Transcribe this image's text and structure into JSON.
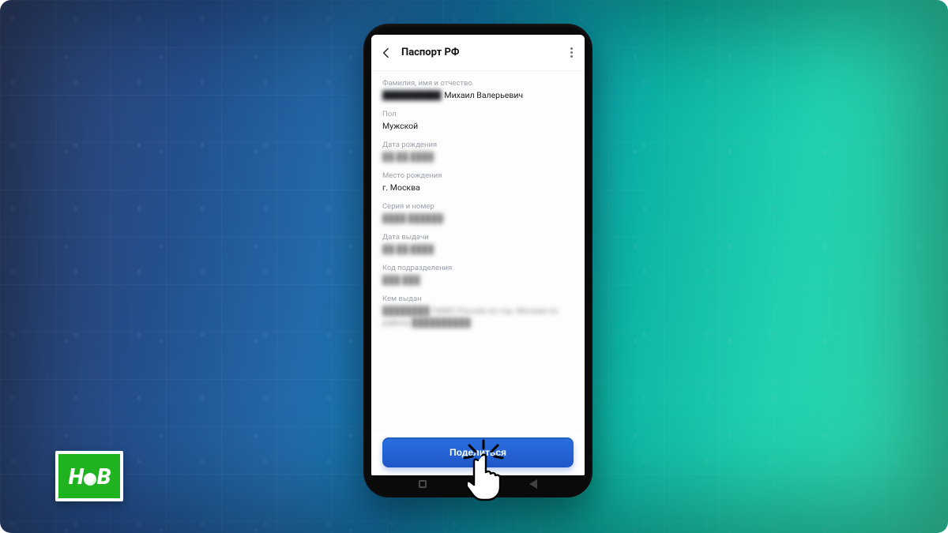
{
  "logo": {
    "left": "Н",
    "right": "В"
  },
  "appbar": {
    "title": "Паспорт РФ",
    "back_icon": "arrow-left",
    "more_icon": "more-vertical"
  },
  "fields": {
    "full_name": {
      "label": "Фамилия, имя и отчество",
      "value_hidden": "██████████",
      "value_visible": "Михаил Валерьевич"
    },
    "gender": {
      "label": "Пол",
      "value": "Мужской"
    },
    "birth_date": {
      "label": "Дата рождения",
      "value_hidden": "██.██.████"
    },
    "birth_place": {
      "label": "Место рождения",
      "value": "г. Москва"
    },
    "series_number": {
      "label": "Серия и номер",
      "value_hidden": "████ ██████"
    },
    "issue_date": {
      "label": "Дата выдачи",
      "value_hidden": "██.██.████"
    },
    "dept_code": {
      "label": "Код подразделения",
      "value_hidden": "███-███"
    },
    "issued_by": {
      "label": "Кем выдан",
      "value_hidden": "████████ УФМС России по гор. Москве по району ██████████"
    }
  },
  "button": {
    "share": "Поделиться"
  },
  "colors": {
    "accent": "#1f57c8",
    "logo_bg": "#1fb41f"
  }
}
